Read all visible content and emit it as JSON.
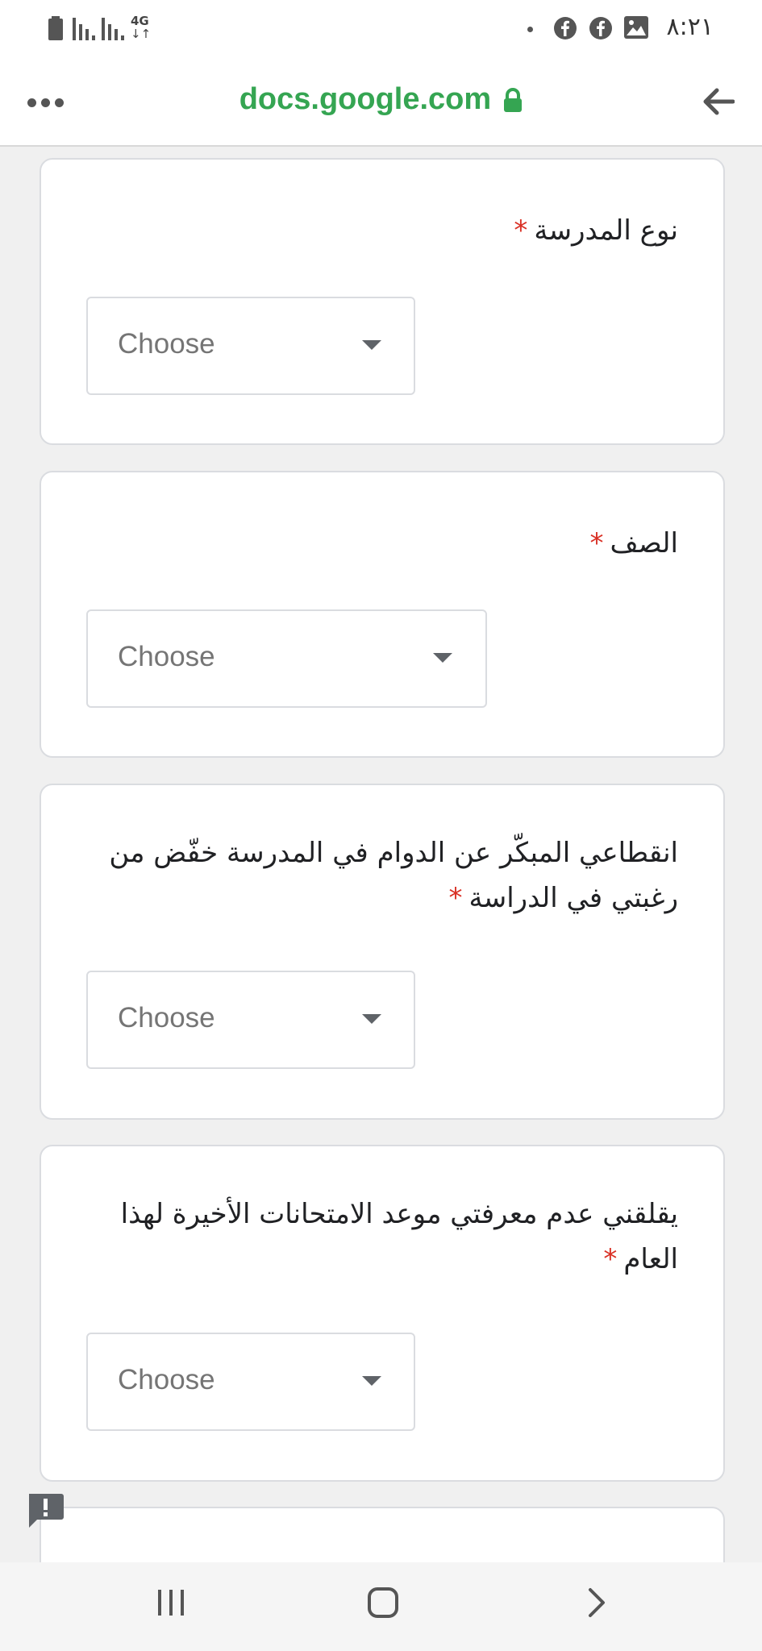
{
  "status_bar": {
    "time": "٨:٢١",
    "network": "4G",
    "network_arrows": "↓↑",
    "icons": [
      "battery-icon",
      "signal-icon",
      "signal-icon",
      "facebook-icon",
      "facebook-icon",
      "gallery-icon"
    ]
  },
  "browser": {
    "url": "docs.google.com",
    "icons": [
      "menu-dots-icon",
      "lock-icon",
      "back-arrow-icon"
    ],
    "accent_color": "#35a552"
  },
  "form": {
    "required_marker": "*",
    "required_color": "#d93025",
    "questions": [
      {
        "label": "نوع المدرسة",
        "dropdown": "Choose"
      },
      {
        "label": "الصف",
        "dropdown": "Choose"
      },
      {
        "label": "انقطاعي المبكّر عن الدوام في المدرسة خفّض من رغبتي في الدراسة",
        "dropdown": "Choose"
      },
      {
        "label": "يقلقني عدم معرفتي موعد الامتحانات الأخيرة لهذا العام",
        "dropdown": "Choose"
      }
    ]
  },
  "feedback": {
    "icon": "report-feedback-icon"
  },
  "nav_bar": {
    "icons": [
      "recent-apps-icon",
      "home-icon",
      "back-icon"
    ]
  }
}
